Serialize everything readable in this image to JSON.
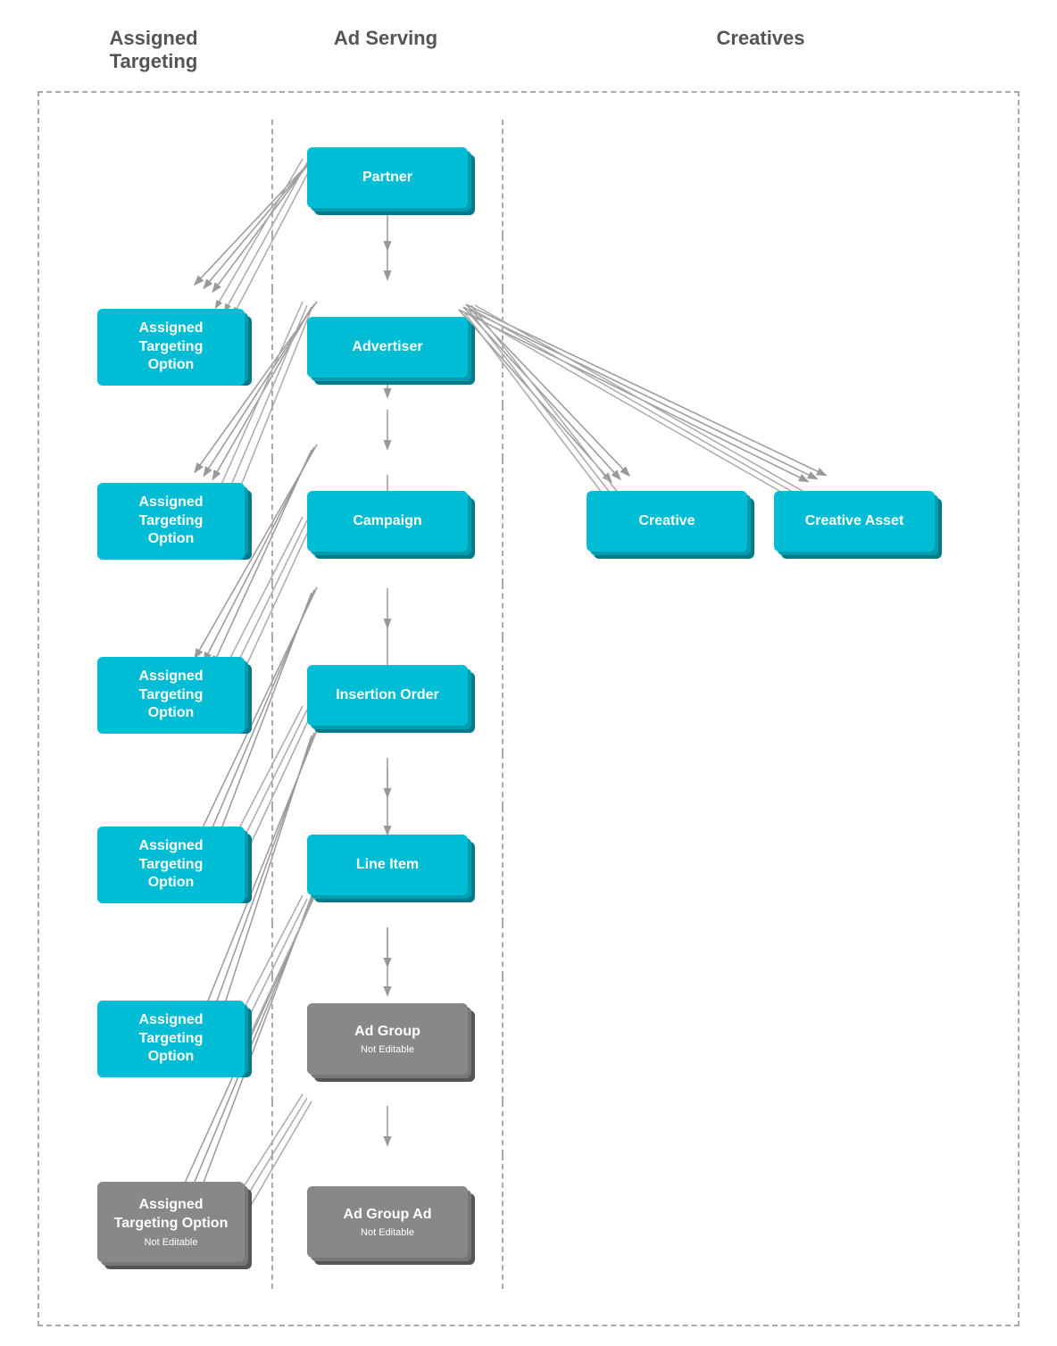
{
  "headers": {
    "assigned_targeting": "Assigned\nTargeting",
    "ad_serving": "Ad Serving",
    "creatives": "Creatives"
  },
  "nodes": {
    "partner": {
      "label": "Partner",
      "type": "teal"
    },
    "advertiser": {
      "label": "Advertiser",
      "type": "teal"
    },
    "campaign": {
      "label": "Campaign",
      "type": "teal"
    },
    "insertion_order": {
      "label": "Insertion Order",
      "type": "teal"
    },
    "line_item": {
      "label": "Line Item",
      "type": "teal"
    },
    "ad_group": {
      "label": "Ad Group",
      "sublabel": "Not Editable",
      "type": "gray"
    },
    "ad_group_ad": {
      "label": "Ad Group Ad",
      "sublabel": "Not Editable",
      "type": "gray"
    },
    "creative": {
      "label": "Creative",
      "type": "teal"
    },
    "creative_asset": {
      "label": "Creative Asset",
      "type": "teal"
    },
    "ato_partner": {
      "label": "Assigned\nTargeting\nOption",
      "type": "ato-teal"
    },
    "ato_advertiser": {
      "label": "Assigned\nTargeting\nOption",
      "type": "ato-teal"
    },
    "ato_campaign": {
      "label": "Assigned\nTargeting\nOption",
      "type": "ato-teal"
    },
    "ato_insertion_order": {
      "label": "Assigned\nTargeting\nOption",
      "type": "ato-teal"
    },
    "ato_line_item": {
      "label": "Assigned\nTargeting\nOption",
      "type": "ato-teal"
    },
    "ato_ad_group": {
      "label": "Assigned\nTargeting Option",
      "sublabel": "Not Editable",
      "type": "ato-gray"
    }
  }
}
